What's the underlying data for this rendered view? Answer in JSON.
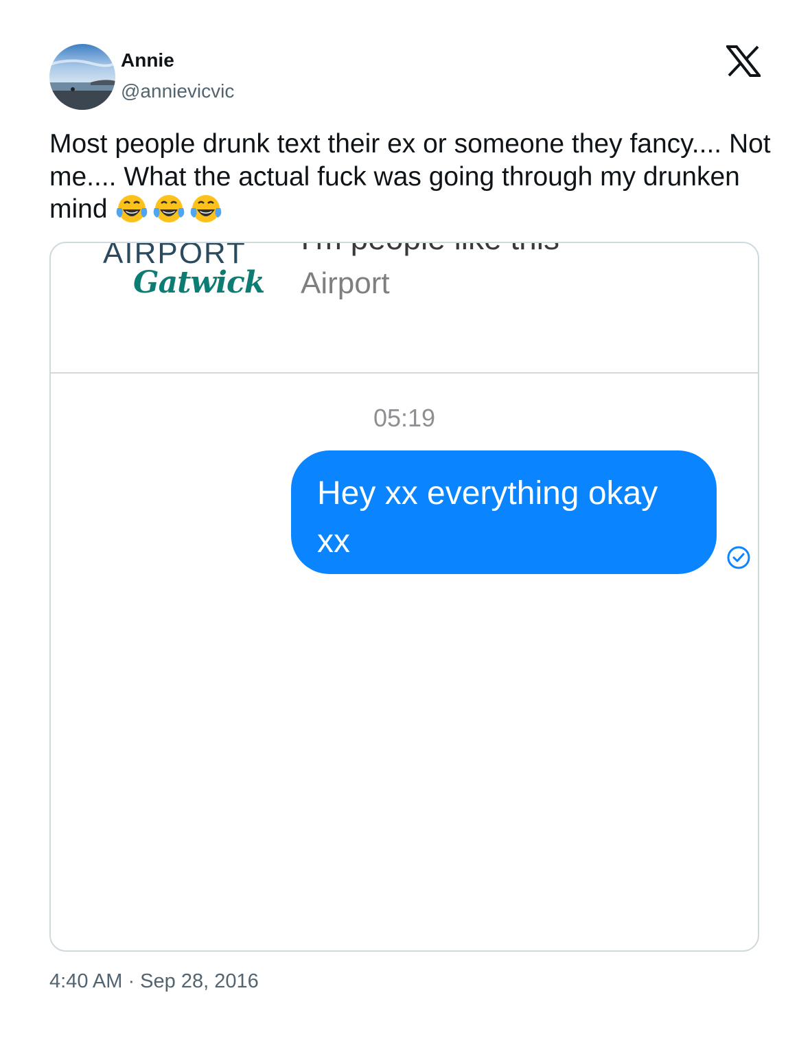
{
  "author": {
    "display_name": "Annie",
    "handle": "@annievicvic",
    "avatar_icon": "beach-landscape-avatar"
  },
  "platform_icon": "x-logo-icon",
  "tweet": {
    "text": "Most people drunk text their ex or someone they fancy.... Not me.... What the actual fuck was going through my drunken mind",
    "emoji": [
      "😂",
      "😂",
      "😂"
    ],
    "emoji_icon": "face-with-tears-of-joy-icon"
  },
  "media": {
    "header_cutoff_text": "I'm people like this",
    "logo_line1": "AIRPORT",
    "logo_line2": "Gatwick",
    "contact_name": "Airport",
    "message_time": "05:19",
    "message_text": "Hey xx everything okay xx",
    "bubble_color": "#0a84ff",
    "read_receipt_icon": "check-circle-icon"
  },
  "footer": {
    "timestamp": "4:40 AM · Sep 28, 2016"
  }
}
